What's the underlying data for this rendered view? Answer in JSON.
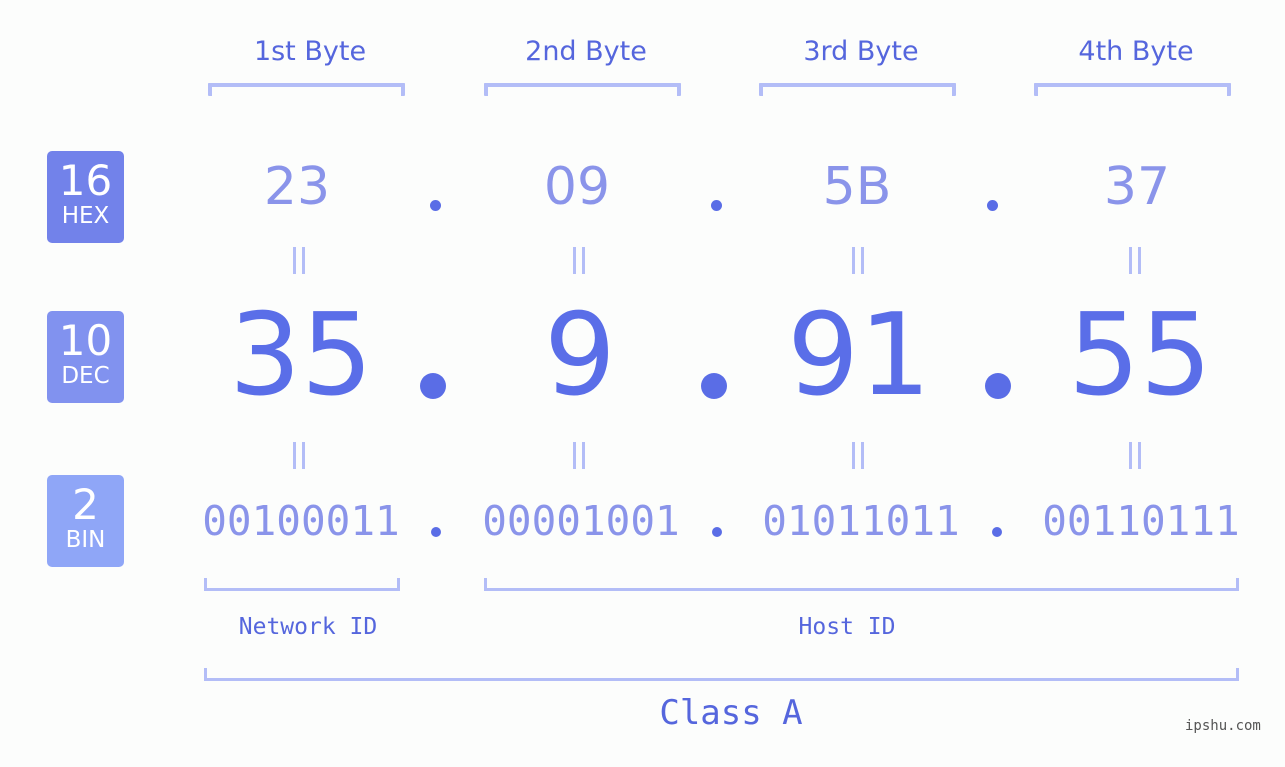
{
  "byte_headers": [
    "1st Byte",
    "2nd Byte",
    "3rd Byte",
    "4th Byte"
  ],
  "badges": {
    "hex": {
      "number": "16",
      "label": "HEX",
      "color": "#7282ea"
    },
    "dec": {
      "number": "10",
      "label": "DEC",
      "color": "#8192ef"
    },
    "bin": {
      "number": "2",
      "label": "BIN",
      "color": "#8fa6f7"
    }
  },
  "ip": {
    "hex": [
      "23",
      "09",
      "5B",
      "37"
    ],
    "dec": [
      "35",
      "9",
      "91",
      "55"
    ],
    "bin": [
      "00100011",
      "00001001",
      "01011011",
      "00110111"
    ],
    "separator": "."
  },
  "segments": {
    "network_label": "Network ID",
    "host_label": "Host ID",
    "class_label": "Class A"
  },
  "watermark": "ipshu.com",
  "colors": {
    "accent": "#5566dd",
    "number_light": "#8a94ea",
    "number_dark": "#5a6ee8",
    "bracket": "#b3bdf7",
    "background": "#fcfdfc"
  }
}
